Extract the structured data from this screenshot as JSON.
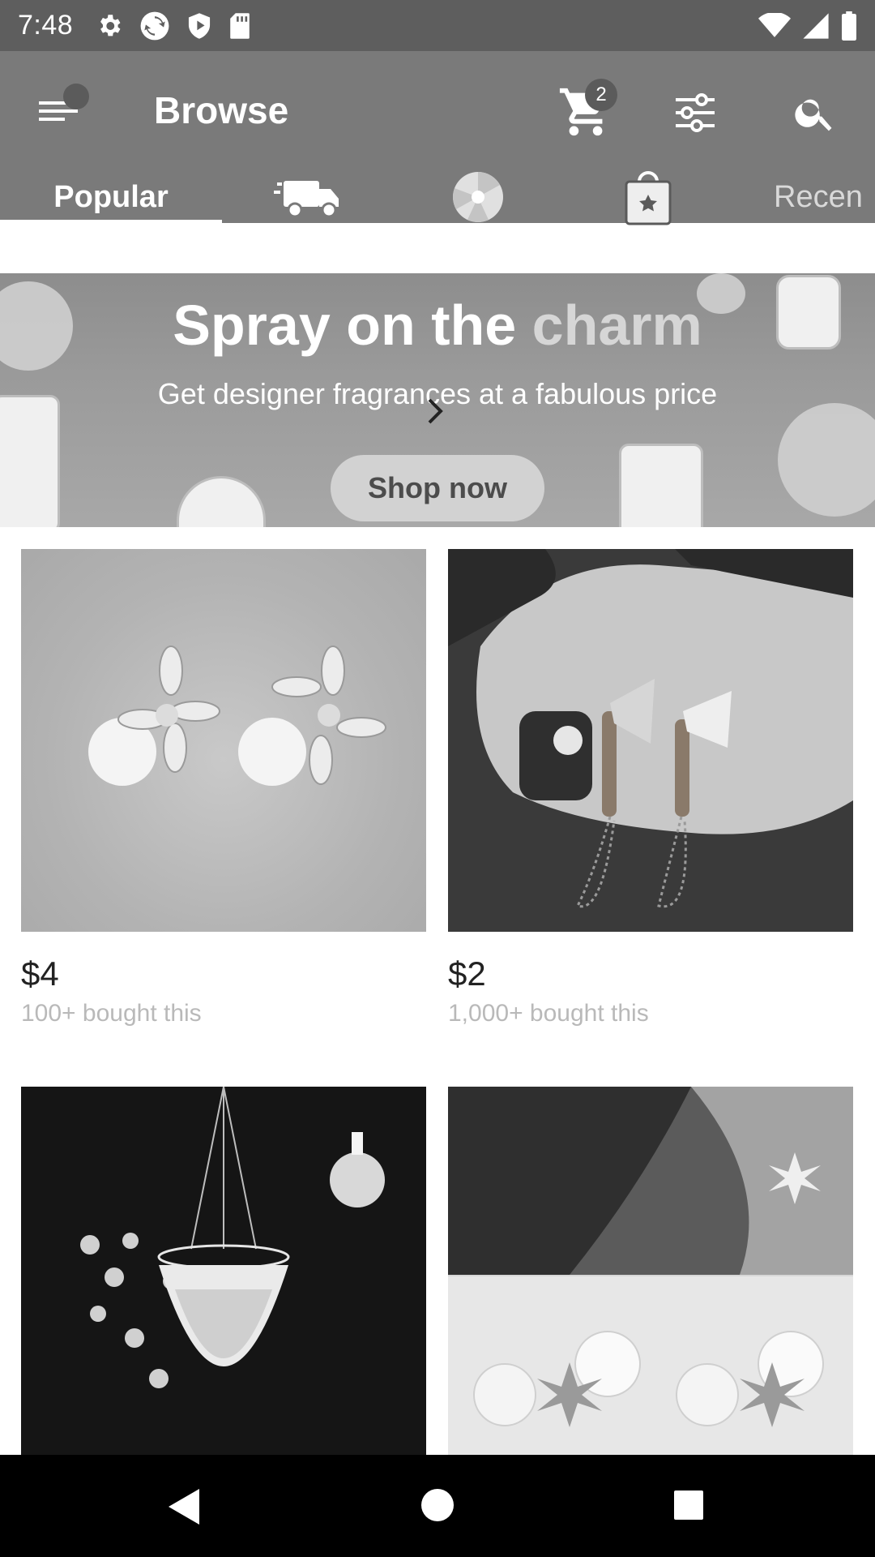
{
  "status_bar": {
    "time": "7:48",
    "icons": [
      "gear-icon",
      "sync-icon",
      "shield-play-icon",
      "sd-card-icon"
    ],
    "right_icons": [
      "wifi-icon",
      "signal-icon",
      "battery-icon"
    ]
  },
  "app_bar": {
    "title": "Browse",
    "cart_count": "2"
  },
  "tabs": {
    "popular": "Popular",
    "recent": "Recen"
  },
  "banner": {
    "title_a": "Spray on the",
    "title_b": "charm",
    "subtitle": "Get designer fragrances at a fabulous price",
    "button": "Shop now"
  },
  "products": [
    {
      "price": "$4",
      "sold": "100+ bought this"
    },
    {
      "price": "$2",
      "sold": "1,000+ bought this"
    },
    {
      "price": "",
      "sold": ""
    },
    {
      "price": "",
      "sold": ""
    }
  ]
}
